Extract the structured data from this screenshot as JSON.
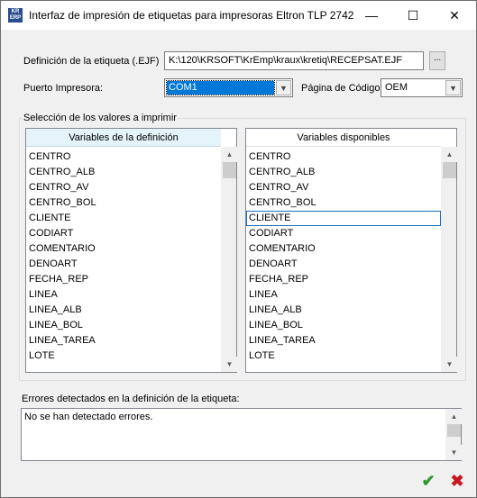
{
  "window": {
    "title": "Interfaz de impresión de etiquetas para impresoras Eltron TLP 2742",
    "icon_text": "KR ERP",
    "minimize_glyph": "—",
    "maximize_glyph": "☐",
    "close_glyph": "✕"
  },
  "definition": {
    "label": "Definición de la etiqueta (.EJF)",
    "value": "K:\\120\\KRSOFT\\KrEmp\\kraux\\kretiq\\RECEPSAT.EJF",
    "browse_label": "..."
  },
  "port": {
    "label": "Puerto Impresora:",
    "selected": "COM1"
  },
  "codepage": {
    "label": "Página de Código:",
    "selected": "OEM"
  },
  "selection": {
    "title": "Selección de los valores a imprimir",
    "definition_list": {
      "header": "Variables de la definición",
      "items": [
        "CENTRO",
        "CENTRO_ALB",
        "CENTRO_AV",
        "CENTRO_BOL",
        "CLIENTE",
        "CODIART",
        "COMENTARIO",
        "DENOART",
        "FECHA_REP",
        "LINEA",
        "LINEA_ALB",
        "LINEA_BOL",
        "LINEA_TAREA",
        "LOTE"
      ]
    },
    "available_list": {
      "header": "Variables disponibles",
      "items": [
        "CENTRO",
        "CENTRO_ALB",
        "CENTRO_AV",
        "CENTRO_BOL",
        "CLIENTE",
        "CODIART",
        "COMENTARIO",
        "DENOART",
        "FECHA_REP",
        "LINEA",
        "LINEA_ALB",
        "LINEA_BOL",
        "LINEA_TAREA",
        "LOTE"
      ],
      "focused_item": "CLIENTE"
    }
  },
  "errors": {
    "label": "Errores detectados en la definición de la etiqueta:",
    "text": "No se han detectado errores."
  },
  "actions": {
    "accept_icon": "check-icon",
    "cancel_icon": "x-icon",
    "accept_color": "#2e9a2e",
    "cancel_color": "#c8181e"
  }
}
